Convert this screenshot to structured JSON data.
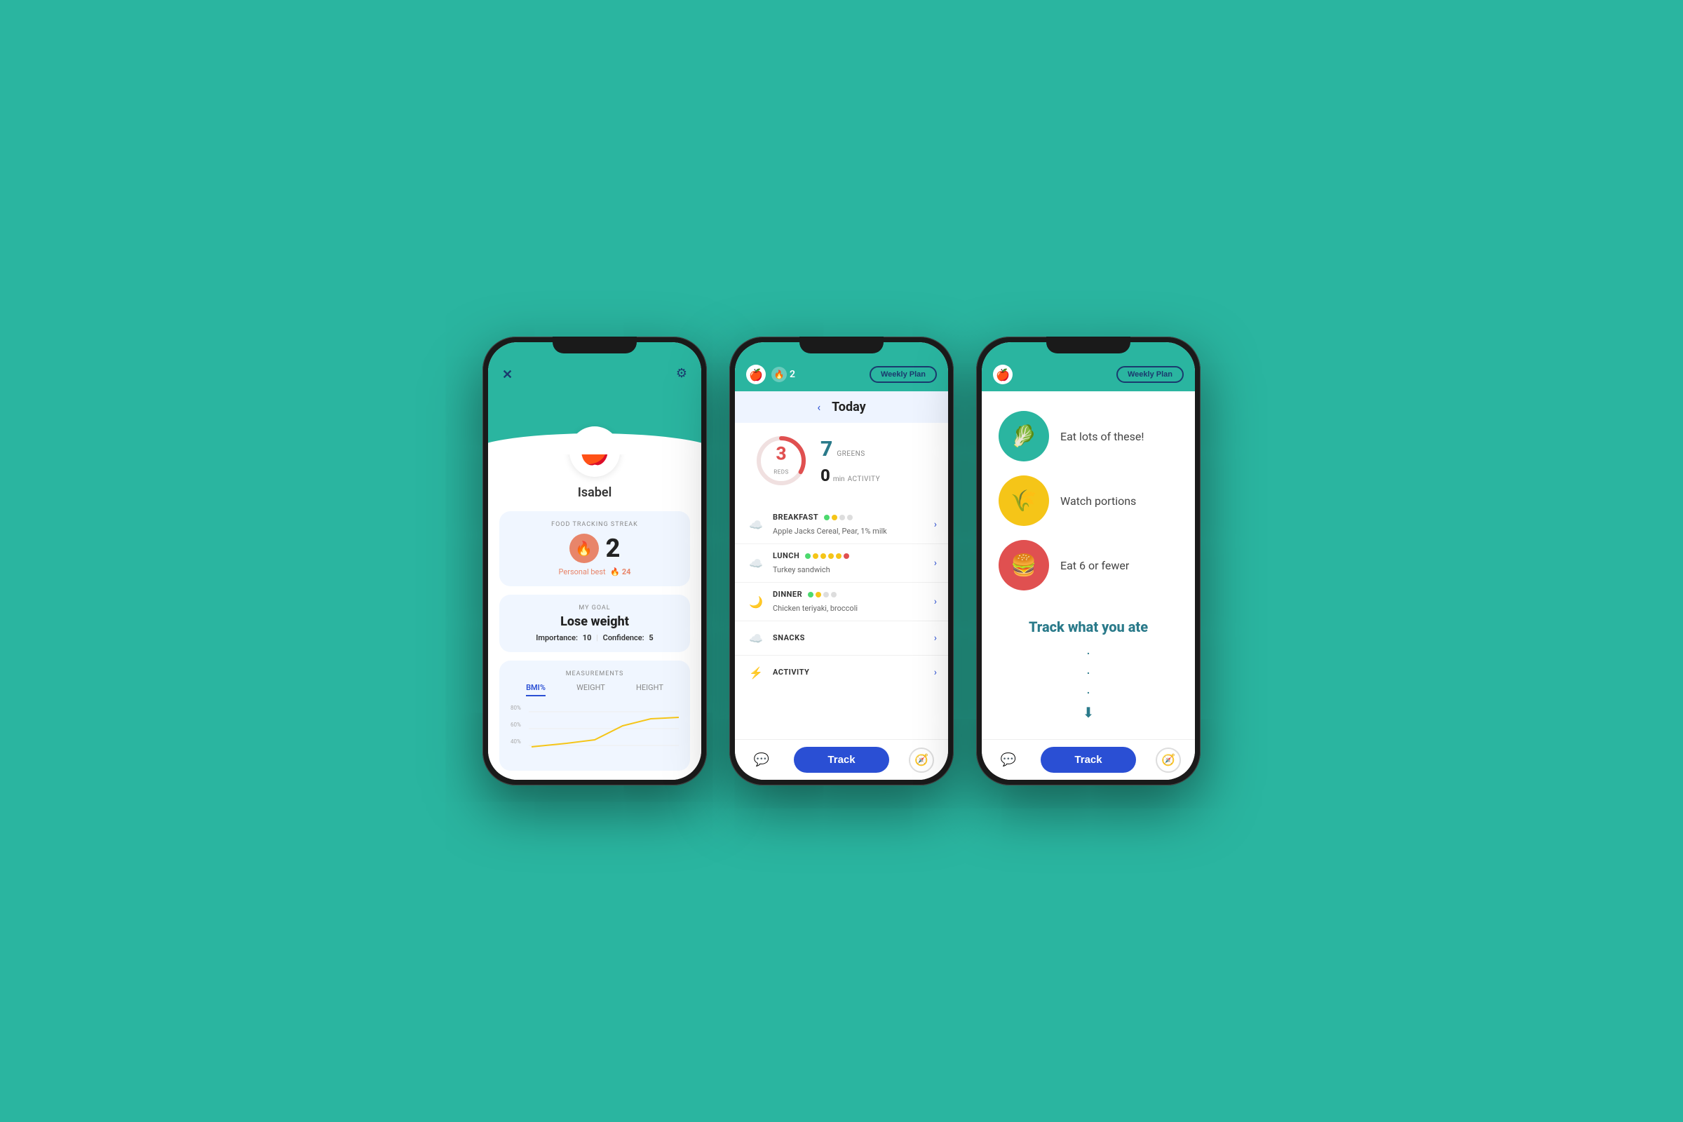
{
  "background_color": "#2ab5a0",
  "phone1": {
    "header": {
      "close_icon": "✕",
      "gear_icon": "⚙"
    },
    "avatar_emoji": "🍎",
    "username": "Isabel",
    "streak_section": {
      "label": "FOOD TRACKING STREAK",
      "streak_number": "2",
      "personal_best_label": "Personal best",
      "personal_best_value": "24"
    },
    "goal_section": {
      "label": "MY GOAL",
      "goal": "Lose weight",
      "importance_label": "Importance:",
      "importance_value": "10",
      "confidence_label": "Confidence:",
      "confidence_value": "5"
    },
    "measurements_section": {
      "label": "MEASUREMENTS",
      "tabs": [
        "BMI%",
        "WEIGHT",
        "HEIGHT"
      ],
      "active_tab": "BMI%",
      "chart_labels": [
        "80%",
        "60%",
        "40%"
      ]
    }
  },
  "phone2": {
    "header": {
      "apple_emoji": "🍎",
      "flame_emoji": "🔥",
      "streak_count": "2",
      "weekly_plan_label": "Weekly Plan"
    },
    "today_nav": {
      "back_arrow": "‹",
      "title": "Today"
    },
    "stats": {
      "reds_number": "3",
      "reds_label": "REDS",
      "greens_number": "7",
      "greens_label": "GREENS",
      "activity_number": "0",
      "activity_unit": "min",
      "activity_label": "ACTIVITY"
    },
    "meals": [
      {
        "name": "BREAKFAST",
        "icon": "☁",
        "description": "Apple Jacks Cereal, Pear, 1% milk",
        "dots": [
          "green",
          "yellow",
          "empty",
          "empty"
        ]
      },
      {
        "name": "LUNCH",
        "icon": "☁",
        "description": "Turkey sandwich",
        "dots": [
          "green",
          "yellow",
          "yellow",
          "yellow",
          "yellow",
          "red"
        ]
      },
      {
        "name": "DINNER",
        "icon": "🌙",
        "description": "Chicken teriyaki, broccoli",
        "dots": [
          "green",
          "yellow",
          "empty",
          "empty"
        ]
      },
      {
        "name": "SNACKS",
        "icon": "☁",
        "description": "",
        "dots": []
      },
      {
        "name": "ACTIVITY",
        "icon": "⚡",
        "description": "",
        "dots": []
      }
    ],
    "bottom_nav": {
      "chat_icon": "💬",
      "track_label": "Track",
      "compass_icon": "🧭"
    }
  },
  "phone3": {
    "header": {
      "apple_emoji": "🍎",
      "weekly_plan_label": "Weekly Plan"
    },
    "food_guide": [
      {
        "circle_color": "green",
        "emoji": "🥬",
        "text": "Eat lots of these!"
      },
      {
        "circle_color": "yellow",
        "emoji": "🌾",
        "text": "Watch portions"
      },
      {
        "circle_color": "red",
        "emoji": "🍔",
        "text": "Eat 6 or fewer"
      }
    ],
    "track_section": {
      "title": "Track what you ate",
      "down_arrow": "⬇"
    },
    "bottom_nav": {
      "chat_icon": "💬",
      "track_label": "Track",
      "compass_icon": "🧭"
    }
  }
}
